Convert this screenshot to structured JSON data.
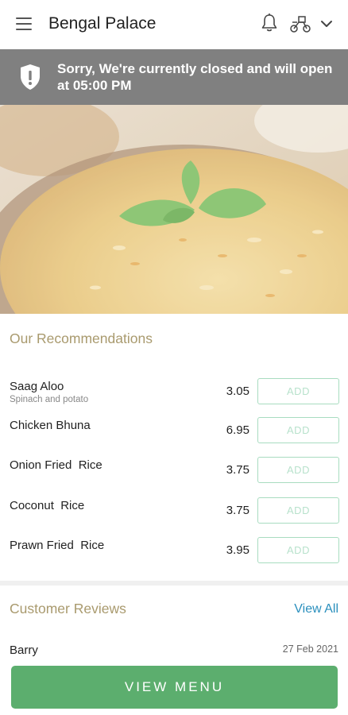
{
  "header": {
    "title": "Bengal Palace",
    "icons": [
      "menu-icon",
      "bell-icon",
      "delivery-bike-icon",
      "chevron-down-icon"
    ]
  },
  "banner": {
    "message": "Sorry, We're currently closed and will open at 05:00 PM",
    "icon": "shield-alert-icon",
    "background": "#808080"
  },
  "hero": {
    "image": "fried-rice-with-mint-photo"
  },
  "recommendations": {
    "title": "Our Recommendations",
    "items": [
      {
        "name": "Saag Aloo",
        "description": "Spinach and potato",
        "price": "3.05",
        "button": "ADD"
      },
      {
        "name": "Chicken Bhuna",
        "description": "",
        "price": "6.95",
        "button": "ADD"
      },
      {
        "name": "Onion Fried  Rice",
        "description": "",
        "price": "3.75",
        "button": "ADD"
      },
      {
        "name": "Coconut  Rice",
        "description": "",
        "price": "3.75",
        "button": "ADD"
      },
      {
        "name": "Prawn Fried  Rice",
        "description": "",
        "price": "3.95",
        "button": "ADD"
      }
    ]
  },
  "reviews": {
    "title": "Customer Reviews",
    "view_all": "View All",
    "items": [
      {
        "name": "Barry",
        "date": "27 Feb 2021"
      }
    ]
  },
  "footer": {
    "view_menu": "VIEW MENU"
  },
  "colors": {
    "accent_green": "#5cae6e",
    "section_title": "#a99a6e",
    "link_blue": "#2a8fbd"
  }
}
